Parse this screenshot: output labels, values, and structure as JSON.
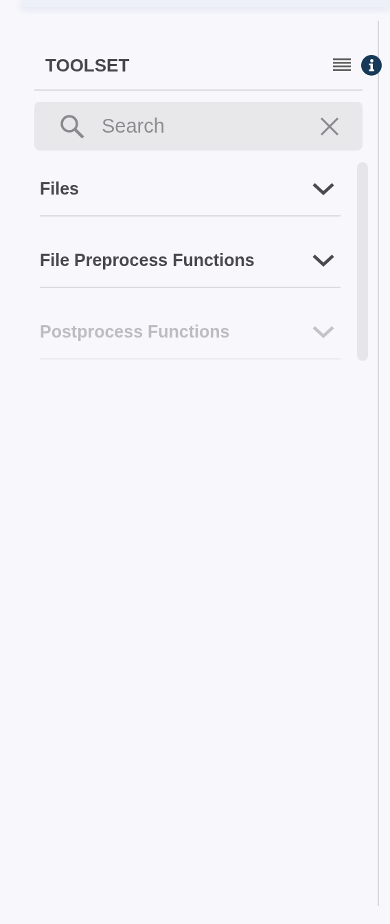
{
  "panel": {
    "title": "TOOLSET"
  },
  "search": {
    "placeholder": "Search"
  },
  "sections": [
    {
      "label": "Files",
      "expanded": false,
      "disabled": false
    },
    {
      "label": "File Preprocess Functions",
      "expanded": false,
      "disabled": false
    },
    {
      "label": "Postprocess Functions",
      "expanded": false,
      "disabled": true
    }
  ]
}
